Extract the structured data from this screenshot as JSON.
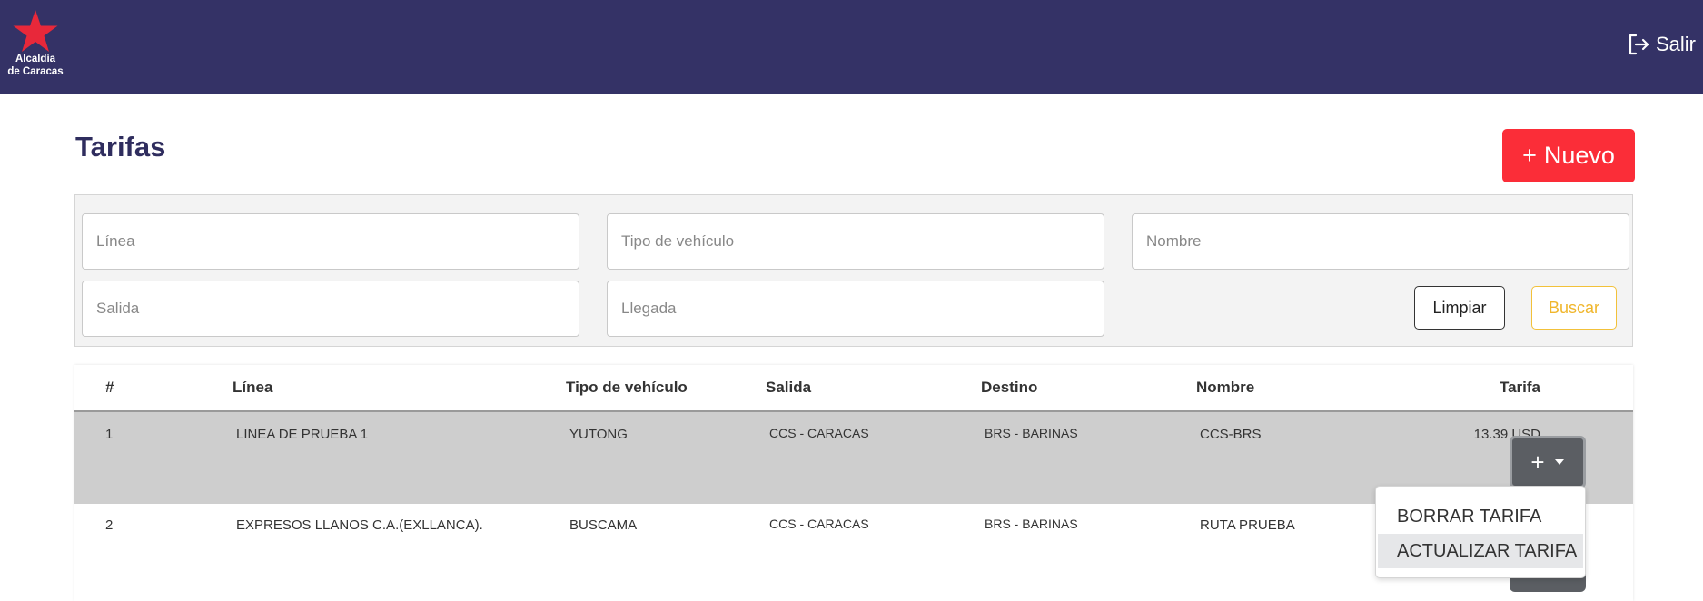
{
  "header": {
    "logo_text": "Alcaldía\nde Caracas",
    "logout_label": "Salir",
    "bg_color": "#343266"
  },
  "page": {
    "title": "Tarifas",
    "new_button_label": "Nuevo",
    "new_button_color": "#fb2d38"
  },
  "filters": {
    "linea_placeholder": "Línea",
    "tipo_placeholder": "Tipo de vehículo",
    "nombre_placeholder": "Nombre",
    "salida_placeholder": "Salida",
    "llegada_placeholder": "Llegada",
    "clear_label": "Limpiar",
    "search_label": "Buscar"
  },
  "table": {
    "columns": [
      "#",
      "Línea",
      "Tipo de vehículo",
      "Salida",
      "Destino",
      "Nombre",
      "Tarifa"
    ],
    "rows": [
      {
        "num": "1",
        "linea": "LINEA DE PRUEBA 1",
        "tipo": "YUTONG",
        "salida": "CCS - CARACAS",
        "destino": "BRS - BARINAS",
        "nombre": "CCS-BRS",
        "tarifa": "13.39 USD"
      },
      {
        "num": "2",
        "linea": "EXPRESOS LLANOS C.A.(EXLLANCA).",
        "tipo": "BUSCAMA",
        "salida": "CCS - CARACAS",
        "destino": "BRS - BARINAS",
        "nombre": "RUTA PRUEBA",
        "tarifa": ""
      }
    ]
  },
  "actions_menu": {
    "items": [
      "BORRAR TARIFA",
      "ACTUALIZAR TARIFA"
    ]
  }
}
